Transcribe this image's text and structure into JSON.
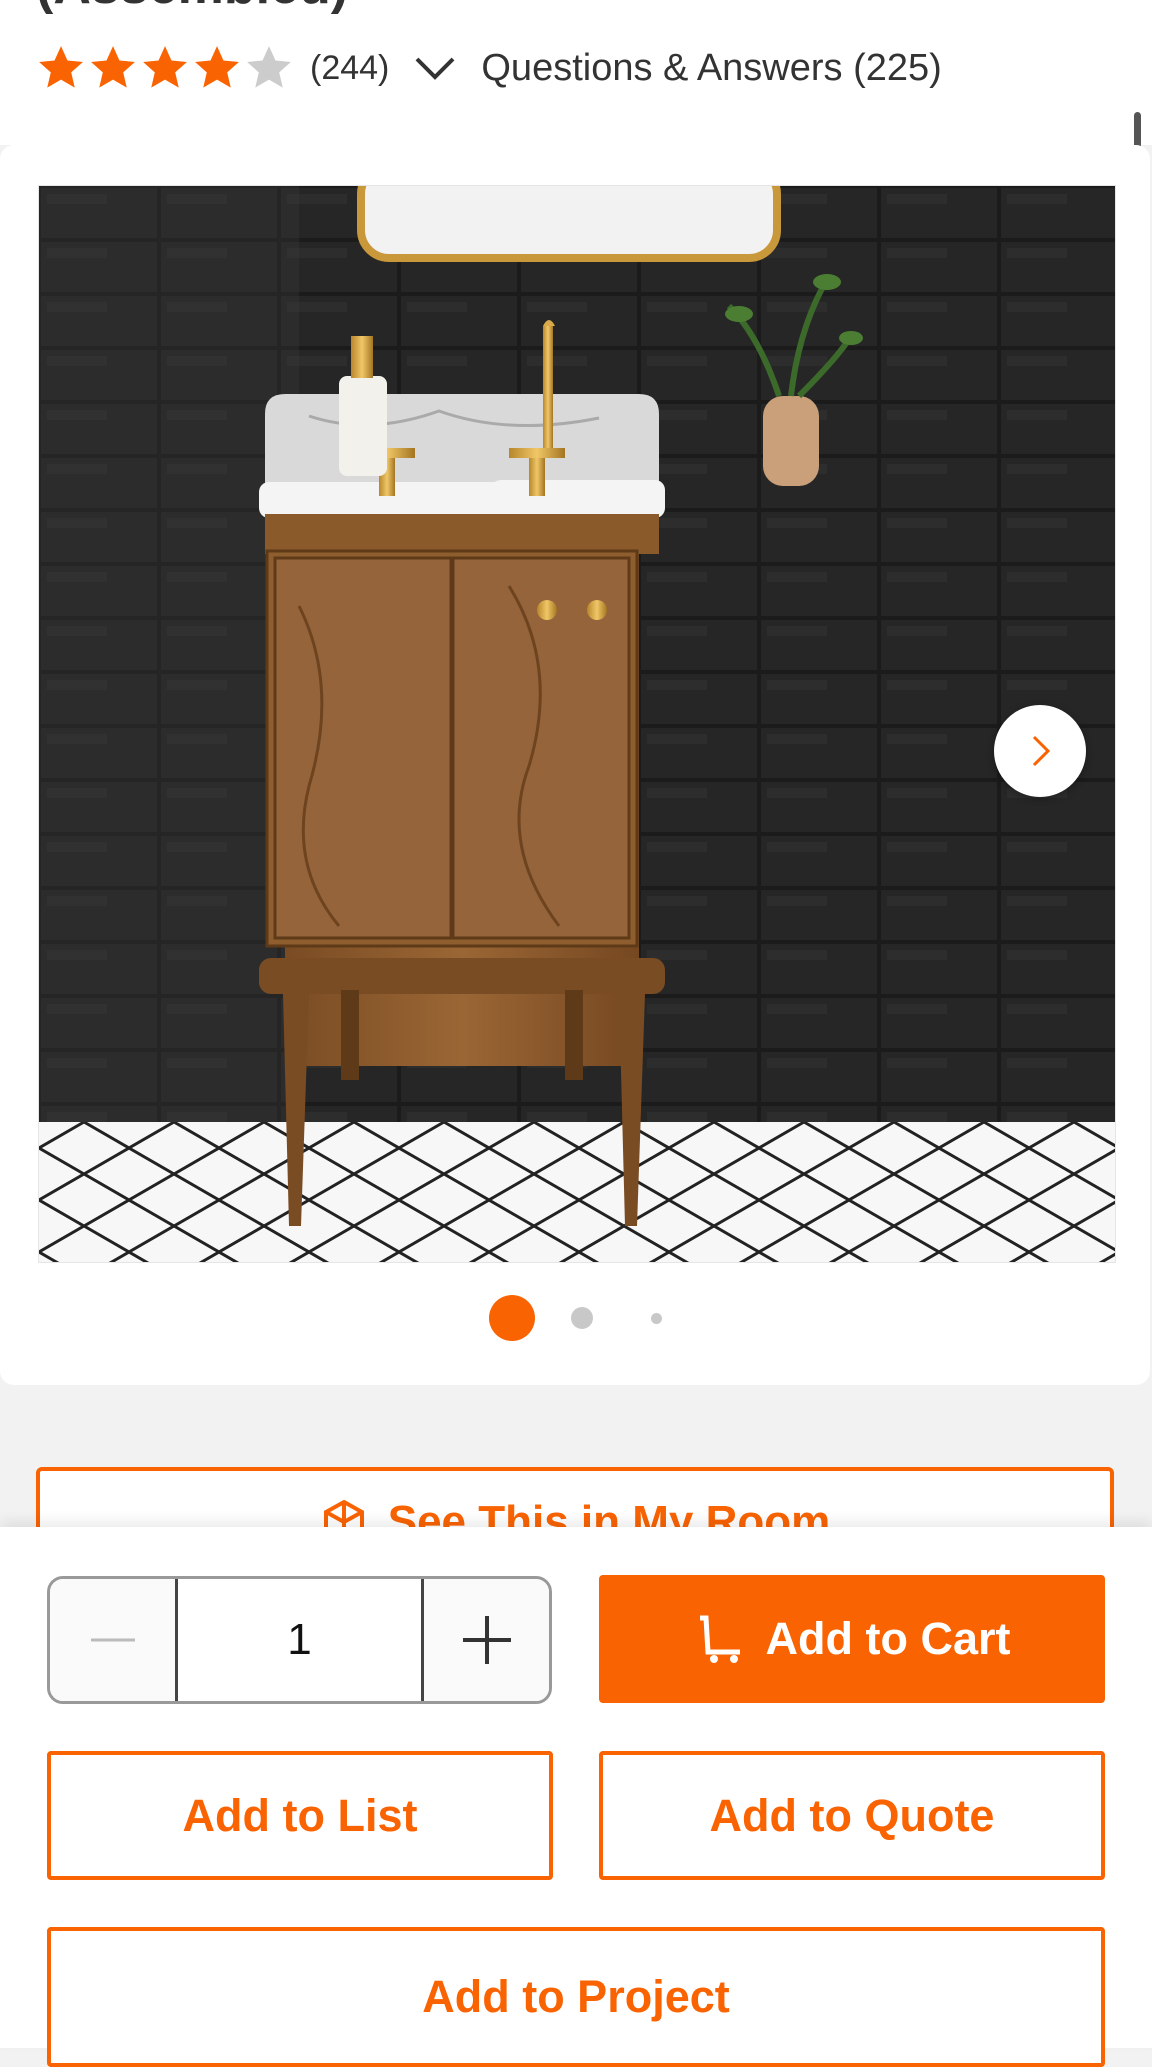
{
  "product": {
    "title_fragment": "(Assembled)",
    "rating": 4,
    "rating_max": 5,
    "review_count": "(244)",
    "qa_label": "Questions & Answers (225)"
  },
  "gallery": {
    "image_count": 3,
    "active_index": 1,
    "next_icon": "chevron-right-icon"
  },
  "ar_button": {
    "label": "See This in My Room",
    "icon": "ar-cube-icon"
  },
  "actions": {
    "quantity": "1",
    "add_to_cart": "Add to Cart",
    "add_to_list": "Add to List",
    "add_to_quote": "Add to Quote",
    "add_to_project": "Add to Project"
  },
  "colors": {
    "brand_orange": "#F96302",
    "star_empty": "#CCCCCC",
    "text": "#333333"
  }
}
